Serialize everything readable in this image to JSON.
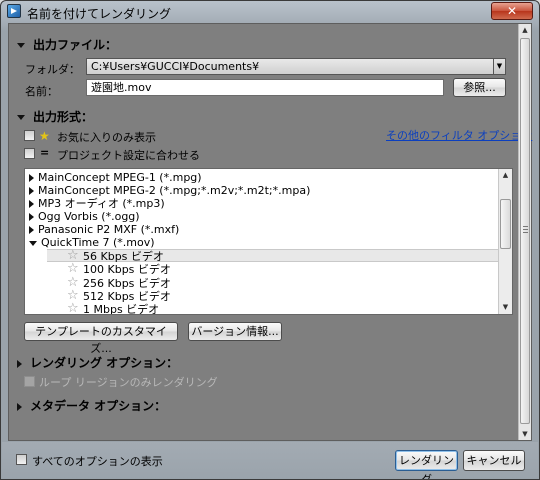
{
  "window": {
    "title": "名前を付けてレンダリング",
    "close_symbol": "✕"
  },
  "output_file": {
    "header": "出力ファイル：",
    "folder_label": "フォルダ：",
    "folder_value": "C:¥Users¥GUCCI¥Documents¥",
    "name_label": "名前：",
    "name_value": "遊園地.mov",
    "browse_label": "参照..."
  },
  "output_format": {
    "header": "出力形式：",
    "favorites_label": "お気に入りのみ表示",
    "match_project_label": "プロジェクト設定に合わせる",
    "more_filters_link": "その他のフィルタ オプション",
    "formats": [
      {
        "label": "MainConcept MPEG-1 (*.mpg)"
      },
      {
        "label": "MainConcept MPEG-2 (*.mpg;*.m2v;*.m2t;*.mpa)"
      },
      {
        "label": "MP3 オーディオ (*.mp3)"
      },
      {
        "label": "Ogg Vorbis (*.ogg)"
      },
      {
        "label": "Panasonic P2 MXF (*.mxf)"
      },
      {
        "label": "QuickTime 7 (*.mov)"
      }
    ],
    "templates": [
      {
        "label": "56 Kbps ビデオ",
        "selected": true
      },
      {
        "label": "100 Kbps ビデオ",
        "selected": false
      },
      {
        "label": "256 Kbps ビデオ",
        "selected": false
      },
      {
        "label": "512 Kbps ビデオ",
        "selected": false
      },
      {
        "label": "1 Mbps ビデオ",
        "selected": false
      }
    ],
    "customize_template_label": "テンプレートのカスタマイズ...",
    "version_info_label": "バージョン情報..."
  },
  "render_options": {
    "header": "レンダリング オプション：",
    "loop_region_label": "ループ リージョンのみレンダリング"
  },
  "metadata_options": {
    "header": "メタデータ オプション："
  },
  "footer": {
    "show_all_label": "すべてのオプションの表示",
    "render_label": "レンダリング",
    "cancel_label": "キャンセル"
  },
  "icons": {
    "favorite": "star-icon",
    "match": "equals-icon"
  },
  "colors": {
    "link": "#0b3fbf",
    "favorite_star": "#e3c417",
    "panel_bg": "#7f7f7f"
  }
}
